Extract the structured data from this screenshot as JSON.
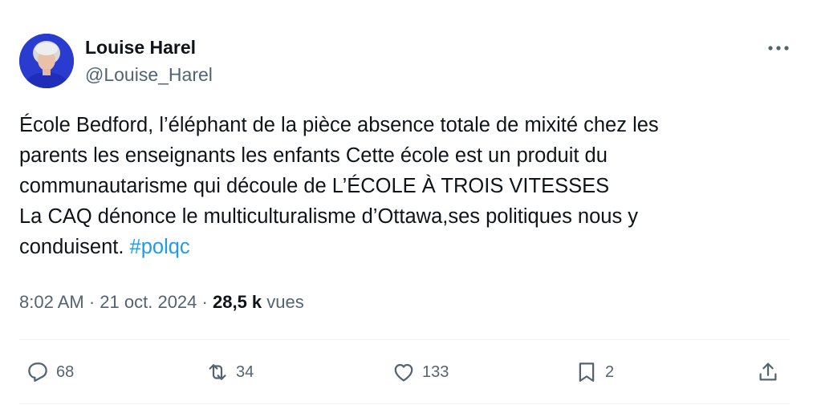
{
  "author": {
    "name": "Louise Harel",
    "handle": "@Louise_Harel"
  },
  "tweet": {
    "lines": [
      "École Bedford, l’éléphant de la pièce absence totale de mixité chez les",
      "parents les enseignants les enfants Cette école est un produit du",
      "communautarisme qui découle de L’ÉCOLE À TROIS VITESSES",
      "La CAQ dénonce le multiculturalisme d’Ottawa,ses politiques nous y",
      "conduisent."
    ],
    "hashtag": "#polqc"
  },
  "meta": {
    "time": "8:02 AM",
    "separator": "·",
    "date": "21 oct. 2024",
    "views_count": "28,5 k",
    "views_label": "vues"
  },
  "actions": {
    "replies": "68",
    "reposts": "34",
    "likes": "133",
    "bookmarks": "2"
  },
  "icons": {
    "more": "more-horizontal-icon",
    "reply": "reply-bubble-icon",
    "repost": "repost-arrows-icon",
    "like": "heart-icon",
    "bookmark": "bookmark-icon",
    "share": "share-upload-icon"
  },
  "colors": {
    "text": "#0f1419",
    "secondary": "#536471",
    "link": "#1d9bf0",
    "divider": "#eff3f4",
    "avatar_background": "#1d2fbf"
  }
}
